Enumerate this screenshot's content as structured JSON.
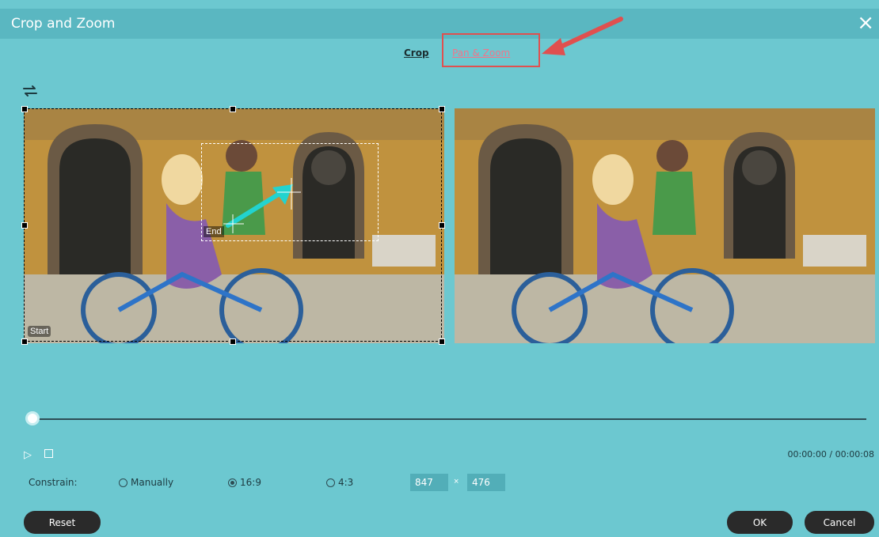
{
  "window": {
    "title": "Crop and Zoom",
    "close_icon": "×"
  },
  "tabs": [
    {
      "label": "Crop"
    },
    {
      "label": "Pan & Zoom"
    }
  ],
  "preview": {
    "end_label": "End",
    "start_label": "Start"
  },
  "playback": {
    "timecode": "00:00:00 / 00:00:08"
  },
  "constrain": {
    "label": "Constrain:",
    "options": [
      {
        "label": "Manually"
      },
      {
        "label": "16:9"
      },
      {
        "label": "4:3"
      }
    ],
    "selected": "16:9",
    "width": "847",
    "separator": "×",
    "height": "476"
  },
  "buttons": {
    "reset": "Reset",
    "ok": "OK",
    "cancel": "Cancel"
  },
  "colors": {
    "background": "#6cc8d0",
    "titlebar": "#5ab7c1",
    "highlight": "#e0504f",
    "tab_active": "#f0758a"
  }
}
